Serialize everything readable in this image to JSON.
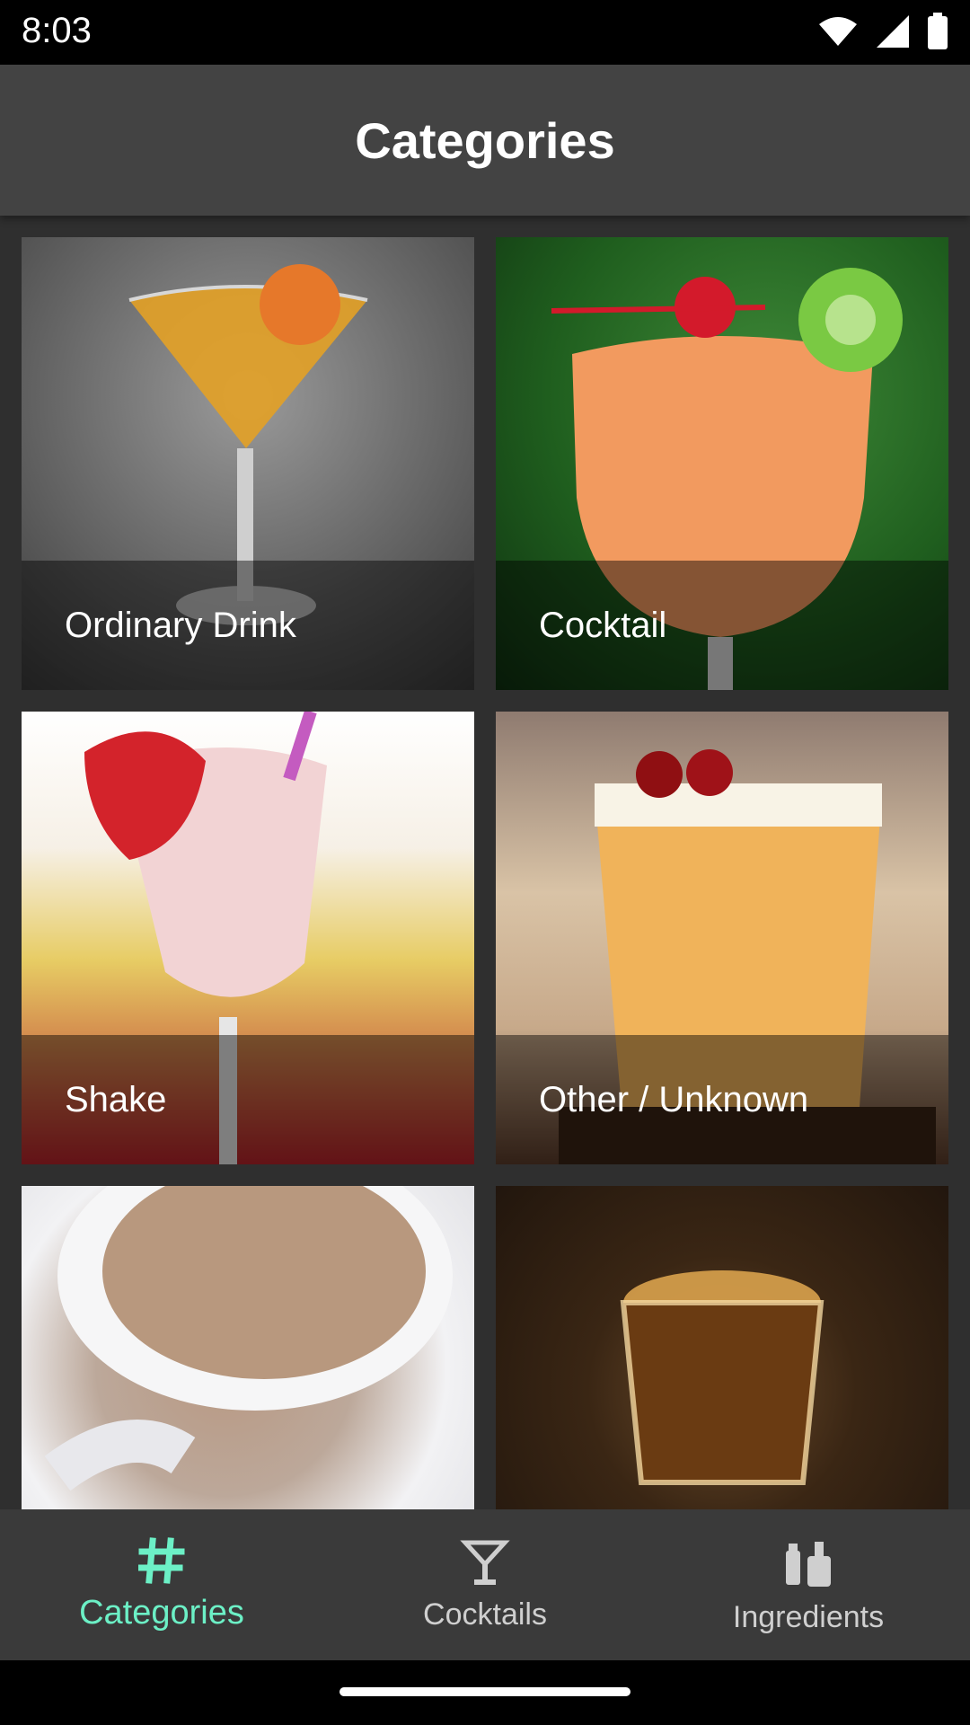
{
  "status_bar": {
    "time": "8:03",
    "icons": [
      "wifi-icon",
      "signal-icon",
      "battery-icon"
    ]
  },
  "app_bar": {
    "title": "Categories"
  },
  "categories": [
    {
      "label": "Ordinary Drink",
      "image": "martini-glass-photo"
    },
    {
      "label": "Cocktail",
      "image": "fruit-cocktail-photo"
    },
    {
      "label": "Shake",
      "image": "strawberry-shake-photo"
    },
    {
      "label": "Other / Unknown",
      "image": "iced-drink-photo"
    },
    {
      "label": "",
      "image": "coffee-cup-photo"
    },
    {
      "label": "",
      "image": "shot-glass-photo"
    }
  ],
  "bottom_nav": {
    "items": [
      {
        "label": "Categories",
        "icon": "hash-icon",
        "active": true
      },
      {
        "label": "Cocktails",
        "icon": "cocktail-glass-icon",
        "active": false
      },
      {
        "label": "Ingredients",
        "icon": "bottles-icon",
        "active": false
      }
    ]
  },
  "colors": {
    "background": "#2f2f2f",
    "app_bar": "#434343",
    "accent": "#6cf0c6",
    "nav_inactive": "#cfcfcf"
  }
}
